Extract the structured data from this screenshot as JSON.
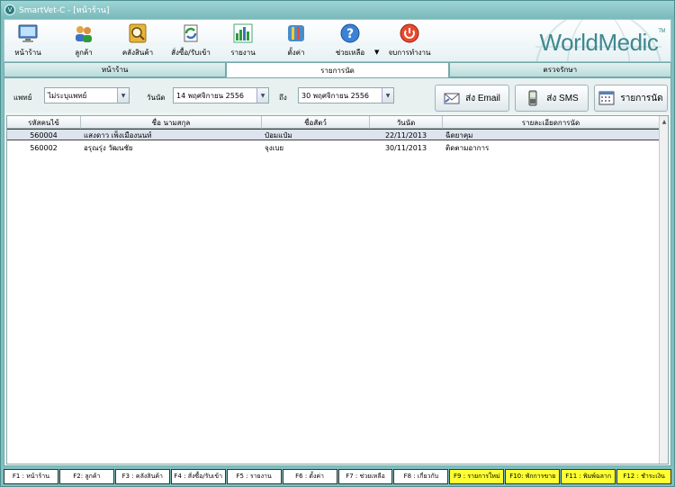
{
  "window": {
    "title": "SmartVet-C - [หน้าร้าน]"
  },
  "toolbar": {
    "items": [
      {
        "label": "หน้าร้าน",
        "icon": "monitor-icon"
      },
      {
        "label": "ลูกค้า",
        "icon": "users-icon"
      },
      {
        "label": "คลังสินค้า",
        "icon": "inventory-icon"
      },
      {
        "label": "สั่งซื้อ/รับเข้า",
        "icon": "order-refresh-icon"
      },
      {
        "label": "รายงาน",
        "icon": "chart-icon"
      },
      {
        "label": "ตั้งค่า",
        "icon": "settings-tools-icon"
      },
      {
        "label": "ช่วยเหลือ",
        "icon": "help-icon"
      },
      {
        "label": "จบการทำงาน",
        "icon": "power-icon"
      }
    ],
    "brand": "WorldMedic",
    "brand_tm": "TM"
  },
  "tabs": [
    {
      "label": "หน้าร้าน"
    },
    {
      "label": "รายการนัด"
    },
    {
      "label": "ตรวจรักษา"
    }
  ],
  "filter": {
    "doctor_label": "แพทย์",
    "doctor_value": "ไม่ระบุแพทย์",
    "date_label": "วันนัด",
    "date_from": "14 พฤศจิกายน  2556",
    "to_label": "ถึง",
    "date_to": "30 พฤศจิกายน  2556"
  },
  "actions": {
    "email": "ส่ง Email",
    "sms": "ส่ง SMS",
    "list": "รายการนัด"
  },
  "grid": {
    "columns": [
      "รหัสคนไข้",
      "ชื่อ นามสกุล",
      "ชื่อสัตว์",
      "วันนัด",
      "รายละเอียดการนัด"
    ],
    "rows": [
      [
        "560004",
        "แสงดาว  เพ็งเมืองนนท์",
        "ป๋อมแป๋ม",
        "22/11/2013",
        "ฉีดยาคุม"
      ],
      [
        "560002",
        "อรุณรุ่ง  วัฒนชัย",
        "จุงเบย",
        "30/11/2013",
        "ติดตามอาการ"
      ]
    ]
  },
  "fkeys": [
    {
      "label": "F1 : หน้าร้าน",
      "highlight": false
    },
    {
      "label": "F2: ลูกค้า",
      "highlight": false
    },
    {
      "label": "F3 : คลังสินค้า",
      "highlight": false
    },
    {
      "label": "F4 : สั่งซื้อ/รับเข้า",
      "highlight": false
    },
    {
      "label": "F5 : รายงาน",
      "highlight": false
    },
    {
      "label": "F6 : ตั้งค่า",
      "highlight": false
    },
    {
      "label": "F7 : ช่วยเหลือ",
      "highlight": false
    },
    {
      "label": "F8 : เกี่ยวกับ",
      "highlight": false
    },
    {
      "label": "F9 : รายการใหม่",
      "highlight": true
    },
    {
      "label": "F10: พักการขาย",
      "highlight": true
    },
    {
      "label": "F11 : พิมพ์ฉลาก",
      "highlight": true
    },
    {
      "label": "F12 : ชำระเงิน",
      "highlight": true
    }
  ]
}
